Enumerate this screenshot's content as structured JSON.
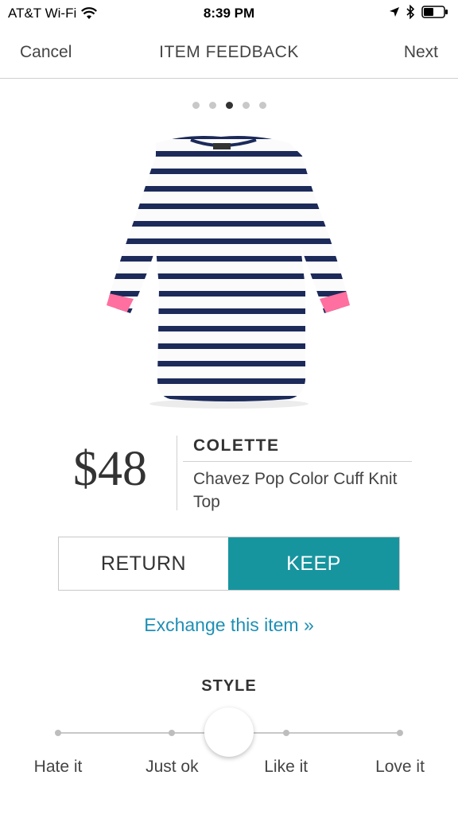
{
  "status_bar": {
    "carrier": "AT&T Wi-Fi",
    "time": "8:39 PM",
    "icons": [
      "wifi-icon",
      "location-arrow-icon",
      "bluetooth-icon",
      "battery-icon"
    ]
  },
  "nav": {
    "cancel_label": "Cancel",
    "title": "ITEM FEEDBACK",
    "next_label": "Next"
  },
  "pager": {
    "total": 5,
    "active_index": 3
  },
  "product": {
    "price": "$48",
    "brand": "COLETTE",
    "name": "Chavez Pop Color Cuff Knit Top",
    "image": "striped-knit-top-image"
  },
  "actions": {
    "return_label": "RETURN",
    "keep_label": "KEEP",
    "exchange_link": "Exchange this item »"
  },
  "style_rating": {
    "heading": "STYLE",
    "options": [
      "Hate it",
      "Just ok",
      "Like it",
      "Love it"
    ],
    "selected_fraction": 0.5
  },
  "colors": {
    "keep_accent": "#17959f",
    "link": "#1f8fb4",
    "stripe": "#1c2a5a",
    "cuff_pink": "#ff6fa0"
  }
}
